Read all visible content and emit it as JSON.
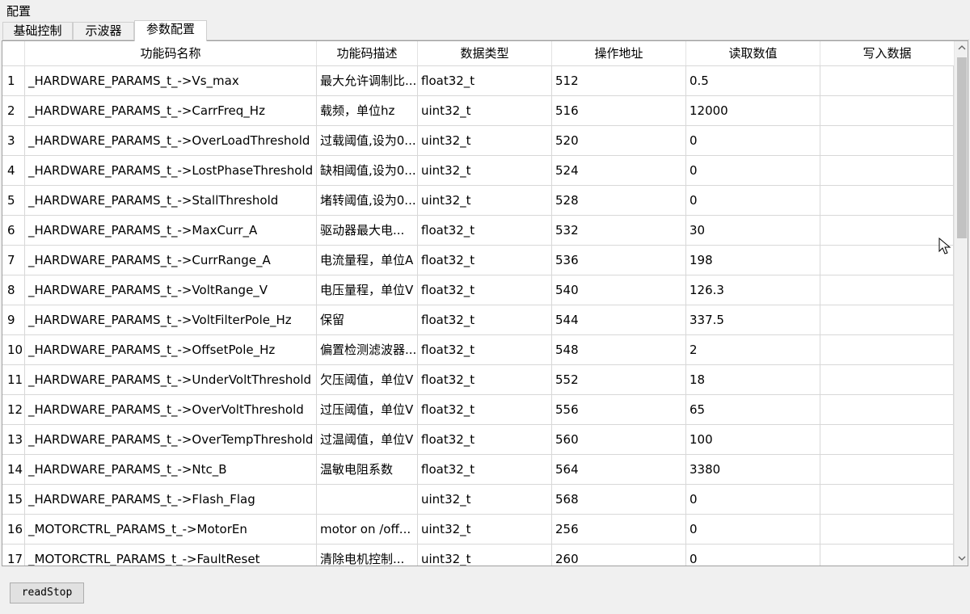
{
  "window": {
    "title": "配置"
  },
  "tabs": [
    {
      "label": "基础控制"
    },
    {
      "label": "示波器"
    },
    {
      "label": "参数配置"
    }
  ],
  "table": {
    "headers": {
      "name": "功能码名称",
      "desc": "功能码描述",
      "type": "数据类型",
      "addr": "操作地址",
      "read": "读取数值",
      "write": "写入数据"
    },
    "rows": [
      {
        "idx": "1",
        "name": "_HARDWARE_PARAMS_t_->Vs_max",
        "desc": "最大允许调制比...",
        "type": "float32_t",
        "addr": "512",
        "read": "0.5",
        "write": ""
      },
      {
        "idx": "2",
        "name": "_HARDWARE_PARAMS_t_->CarrFreq_Hz",
        "desc": "载频，单位hz",
        "type": "uint32_t",
        "addr": "516",
        "read": "12000",
        "write": ""
      },
      {
        "idx": "3",
        "name": "_HARDWARE_PARAMS_t_->OverLoadThreshold",
        "desc": "过载阈值,设为0...",
        "type": "uint32_t",
        "addr": "520",
        "read": "0",
        "write": ""
      },
      {
        "idx": "4",
        "name": "_HARDWARE_PARAMS_t_->LostPhaseThreshold",
        "desc": "缺相阈值,设为0...",
        "type": "uint32_t",
        "addr": "524",
        "read": "0",
        "write": ""
      },
      {
        "idx": "5",
        "name": "_HARDWARE_PARAMS_t_->StallThreshold",
        "desc": "堵转阈值,设为0...",
        "type": "uint32_t",
        "addr": "528",
        "read": "0",
        "write": ""
      },
      {
        "idx": "6",
        "name": "_HARDWARE_PARAMS_t_->MaxCurr_A",
        "desc": "驱动器最大电...",
        "type": "float32_t",
        "addr": "532",
        "read": "30",
        "write": ""
      },
      {
        "idx": "7",
        "name": "_HARDWARE_PARAMS_t_->CurrRange_A",
        "desc": "电流量程，单位A",
        "type": "float32_t",
        "addr": "536",
        "read": "198",
        "write": ""
      },
      {
        "idx": "8",
        "name": "_HARDWARE_PARAMS_t_->VoltRange_V",
        "desc": "电压量程，单位V",
        "type": "float32_t",
        "addr": "540",
        "read": "126.3",
        "write": ""
      },
      {
        "idx": "9",
        "name": "_HARDWARE_PARAMS_t_->VoltFilterPole_Hz",
        "desc": "保留",
        "type": "float32_t",
        "addr": "544",
        "read": "337.5",
        "write": ""
      },
      {
        "idx": "10",
        "name": "_HARDWARE_PARAMS_t_->OffsetPole_Hz",
        "desc": "偏置检测滤波器...",
        "type": "float32_t",
        "addr": "548",
        "read": "2",
        "write": ""
      },
      {
        "idx": "11",
        "name": "_HARDWARE_PARAMS_t_->UnderVoltThreshold",
        "desc": "欠压阈值，单位V",
        "type": "float32_t",
        "addr": "552",
        "read": "18",
        "write": ""
      },
      {
        "idx": "12",
        "name": "_HARDWARE_PARAMS_t_->OverVoltThreshold",
        "desc": "过压阈值，单位V",
        "type": "float32_t",
        "addr": "556",
        "read": "65",
        "write": ""
      },
      {
        "idx": "13",
        "name": "_HARDWARE_PARAMS_t_->OverTempThreshold",
        "desc": "过温阈值，单位V",
        "type": "float32_t",
        "addr": "560",
        "read": "100",
        "write": ""
      },
      {
        "idx": "14",
        "name": "_HARDWARE_PARAMS_t_->Ntc_B",
        "desc": "温敏电阻系数",
        "type": "float32_t",
        "addr": "564",
        "read": "3380",
        "write": ""
      },
      {
        "idx": "15",
        "name": "_HARDWARE_PARAMS_t_->Flash_Flag",
        "desc": "",
        "type": "uint32_t",
        "addr": "568",
        "read": "0",
        "write": ""
      },
      {
        "idx": "16",
        "name": "_MOTORCTRL_PARAMS_t_->MotorEn",
        "desc": " motor on /off...",
        "type": "uint32_t",
        "addr": "256",
        "read": "0",
        "write": ""
      },
      {
        "idx": "17",
        "name": "_MOTORCTRL_PARAMS_t_->FaultReset",
        "desc": " 清除电机控制...",
        "type": "uint32_t",
        "addr": "260",
        "read": "0",
        "write": ""
      }
    ]
  },
  "footer": {
    "button_label": "readStop"
  },
  "icons": {
    "scroll_up": "chevron-up-icon",
    "scroll_down": "chevron-down-icon",
    "cursor": "mouse-pointer-icon"
  }
}
